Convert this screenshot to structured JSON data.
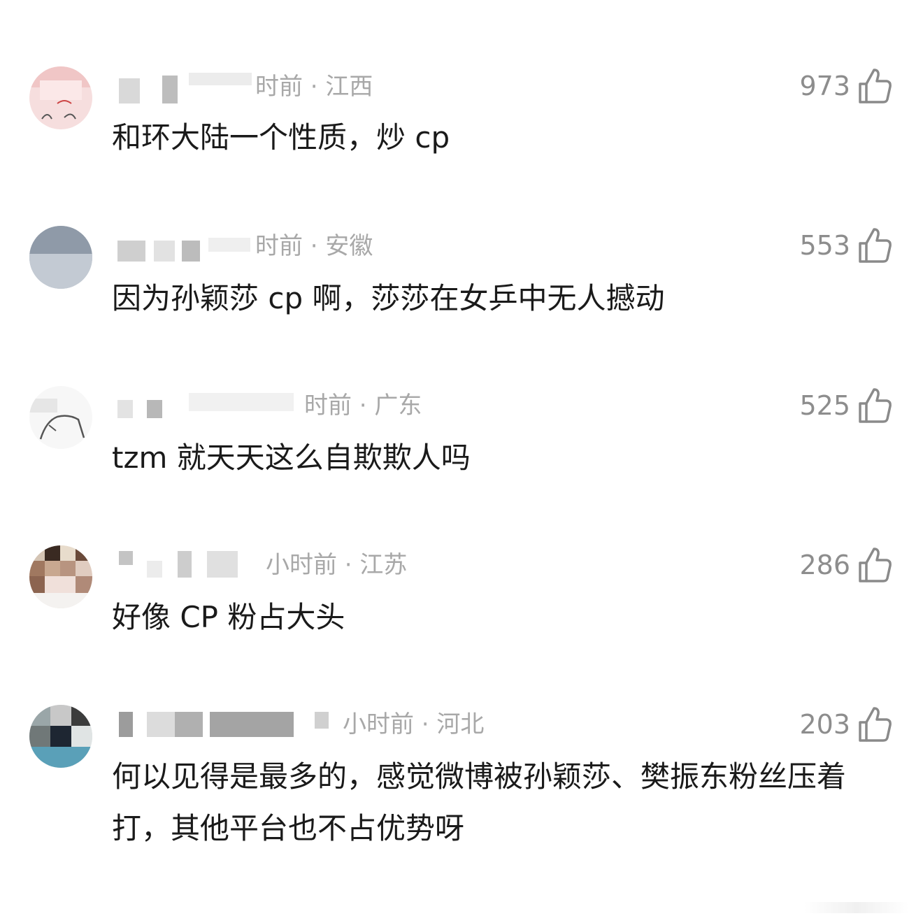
{
  "comments": [
    {
      "meta": "时前 · 江西",
      "likes": "973",
      "text": "和环大陆一个性质，炒 cp"
    },
    {
      "meta": "时前 · 安徽",
      "likes": "553",
      "text": "因为孙颖莎 cp 啊，莎莎在女乒中无人撼动"
    },
    {
      "meta": "时前 · 广东",
      "likes": "525",
      "text": "tzm 就天天这么自欺欺人吗"
    },
    {
      "meta": "小时前 · 江苏",
      "likes": "286",
      "text": "好像 CP 粉占大头"
    },
    {
      "meta": "小时前 · 河北",
      "likes": "203",
      "text": "何以见得是最多的，感觉微博被孙颖莎、樊振东粉丝压着打，其他平台也不占优势呀"
    }
  ],
  "icons": {
    "like": "thumbs-up-icon"
  },
  "colors": {
    "meta": "#a8a8a8",
    "likes": "#8d8d8d",
    "text": "#1a1a1a"
  }
}
